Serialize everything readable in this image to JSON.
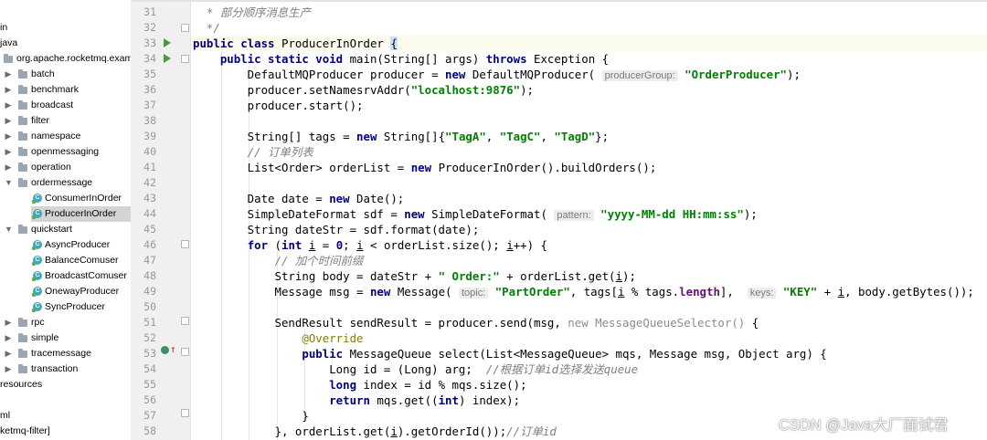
{
  "tree": {
    "rows": [
      {
        "label": "in",
        "indent": 0,
        "kind": "none",
        "arrow": ""
      },
      {
        "label": "java",
        "indent": 0,
        "kind": "none",
        "arrow": ""
      },
      {
        "label": "org.apache.rocketmq.exam",
        "indent": 4,
        "kind": "folder",
        "arrow": ""
      },
      {
        "label": "batch",
        "indent": 1,
        "kind": "folder",
        "arrow": "▶"
      },
      {
        "label": "benchmark",
        "indent": 1,
        "kind": "folder",
        "arrow": "▶"
      },
      {
        "label": "broadcast",
        "indent": 1,
        "kind": "folder",
        "arrow": "▶"
      },
      {
        "label": "filter",
        "indent": 1,
        "kind": "folder",
        "arrow": "▶"
      },
      {
        "label": "namespace",
        "indent": 1,
        "kind": "folder",
        "arrow": "▶"
      },
      {
        "label": "openmessaging",
        "indent": 1,
        "kind": "folder",
        "arrow": "▶"
      },
      {
        "label": "operation",
        "indent": 1,
        "kind": "folder",
        "arrow": "▶"
      },
      {
        "label": "ordermessage",
        "indent": 1,
        "kind": "folder",
        "arrow": "▼"
      },
      {
        "label": "ConsumerInOrder",
        "indent": 2,
        "kind": "class",
        "arrow": ""
      },
      {
        "label": "ProducerInOrder",
        "indent": 2,
        "kind": "class",
        "arrow": "",
        "selected": true
      },
      {
        "label": "quickstart",
        "indent": 1,
        "kind": "folder",
        "arrow": "▼"
      },
      {
        "label": "AsyncProducer",
        "indent": 2,
        "kind": "class",
        "arrow": ""
      },
      {
        "label": "BalanceComuser",
        "indent": 2,
        "kind": "class",
        "arrow": ""
      },
      {
        "label": "BroadcastComuser",
        "indent": 2,
        "kind": "class",
        "arrow": ""
      },
      {
        "label": "OnewayProducer",
        "indent": 2,
        "kind": "class",
        "arrow": ""
      },
      {
        "label": "SyncProducer",
        "indent": 2,
        "kind": "class",
        "arrow": ""
      },
      {
        "label": "rpc",
        "indent": 1,
        "kind": "folder",
        "arrow": "▶"
      },
      {
        "label": "simple",
        "indent": 1,
        "kind": "folder",
        "arrow": "▶"
      },
      {
        "label": "tracemessage",
        "indent": 1,
        "kind": "folder",
        "arrow": "▶"
      },
      {
        "label": "transaction",
        "indent": 1,
        "kind": "folder",
        "arrow": "▶"
      },
      {
        "label": "resources",
        "indent": 0,
        "kind": "none",
        "arrow": ""
      },
      {
        "label": "",
        "indent": 0,
        "kind": "none",
        "arrow": ""
      },
      {
        "label": "ml",
        "indent": 0,
        "kind": "none",
        "arrow": ""
      },
      {
        "label": "ketmq-filter]",
        "indent": 0,
        "kind": "none",
        "arrow": ""
      }
    ]
  },
  "editor": {
    "line_numbers": [
      "31",
      "32",
      "33",
      "34",
      "35",
      "36",
      "37",
      "38",
      "39",
      "40",
      "41",
      "42",
      "43",
      "44",
      "45",
      "46",
      "47",
      "48",
      "49",
      "50",
      "51",
      "52",
      "53",
      "54",
      "55",
      "56",
      "57",
      "58"
    ],
    "lines": {
      "l31": "部分顺序消息生产",
      "l33_class": "ProducerInOrder",
      "l35_hint": "producerGroup:",
      "l35_str": "\"OrderProducer\"",
      "l36_str": "\"localhost:9876\"",
      "l39_s1": "\"TagA\"",
      "l39_s2": "\"TagC\"",
      "l39_s3": "\"TagD\"",
      "l40_cm": "// 订单列表",
      "l44_hint": "pattern:",
      "l44_str": "\"yyyy-MM-dd HH:mm:ss\"",
      "l47_cm": "// 加个时间前缀",
      "l48_str": "\" Order:\"",
      "l49_hint1": "topic:",
      "l49_str1": "\"PartOrder\"",
      "l49_hint2": "keys:",
      "l49_str2": "\"KEY\"",
      "l52_ann": "@Override",
      "l54_cm": "//根据订单id选择发送queue",
      "l58_cm": "//订单id"
    }
  },
  "colors": {
    "keyword": "#000080",
    "string": "#008000",
    "comment": "#808080",
    "annotation": "#808000",
    "run_icon": "#4a9b3f"
  },
  "watermark": "CSDN @Java大厂面试君"
}
